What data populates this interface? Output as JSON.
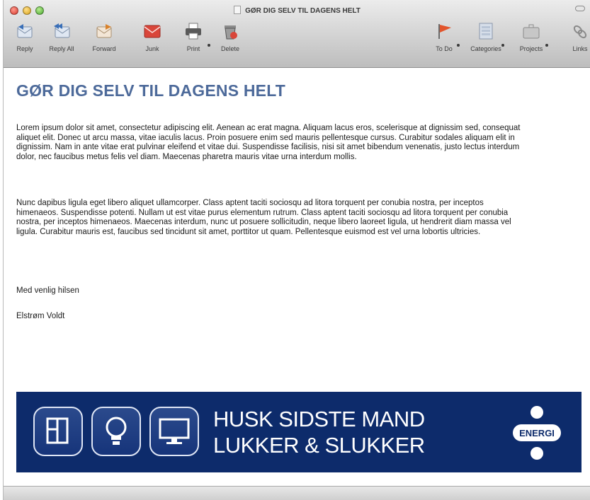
{
  "window": {
    "title": "GØR DIG SELV TIL DAGENS HELT"
  },
  "toolbar": {
    "reply": "Reply",
    "reply_all": "Reply All",
    "forward": "Forward",
    "junk": "Junk",
    "print": "Print",
    "delete": "Delete",
    "todo": "To Do",
    "categories": "Categories",
    "projects": "Projects",
    "links": "Links"
  },
  "message": {
    "heading": "GØR DIG SELV TIL DAGENS HELT",
    "paragraph1": "Lorem ipsum dolor sit amet, consectetur adipiscing elit. Aenean ac erat magna. Aliquam lacus eros, scelerisque at dignissim sed, consequat aliquet elit. Donec ut arcu massa, vitae iaculis lacus. Proin posuere enim sed mauris pellentesque cursus. Curabitur sodales aliquam elit in dignissim. Nam in ante vitae erat pulvinar eleifend et vitae dui. Suspendisse facilisis, nisi sit amet bibendum venenatis, justo lectus interdum dolor, nec faucibus metus felis vel diam. Maecenas pharetra mauris vitae urna interdum mollis.",
    "paragraph2": "Nunc dapibus ligula eget libero aliquet ullamcorper. Class aptent taciti sociosqu ad litora torquent per conubia nostra, per inceptos himenaeos. Suspendisse potenti. Nullam ut est vitae purus elementum rutrum. Class aptent taciti sociosqu ad litora torquent per conubia nostra, per inceptos himenaeos. Maecenas interdum, nunc ut posuere sollicitudin, neque libero laoreet ligula, ut hendrerit diam massa vel ligula. Curabitur mauris est, faucibus sed tincidunt sit amet, porttitor ut quam. Pellentesque euismod est vel urna lobortis ultricies.",
    "greeting": "Med venlig hilsen",
    "signature": "Elstrøm Voldt"
  },
  "banner": {
    "line1": "HUSK SIDSTE MAND",
    "line2": "LUKKER & SLUKKER",
    "logo_text": "ENERGI",
    "bg_color": "#0d2b6b",
    "icons": [
      "window-icon",
      "lightbulb-icon",
      "monitor-icon"
    ]
  },
  "colors": {
    "heading": "#4d6a9a",
    "banner": "#0d2b6b"
  }
}
